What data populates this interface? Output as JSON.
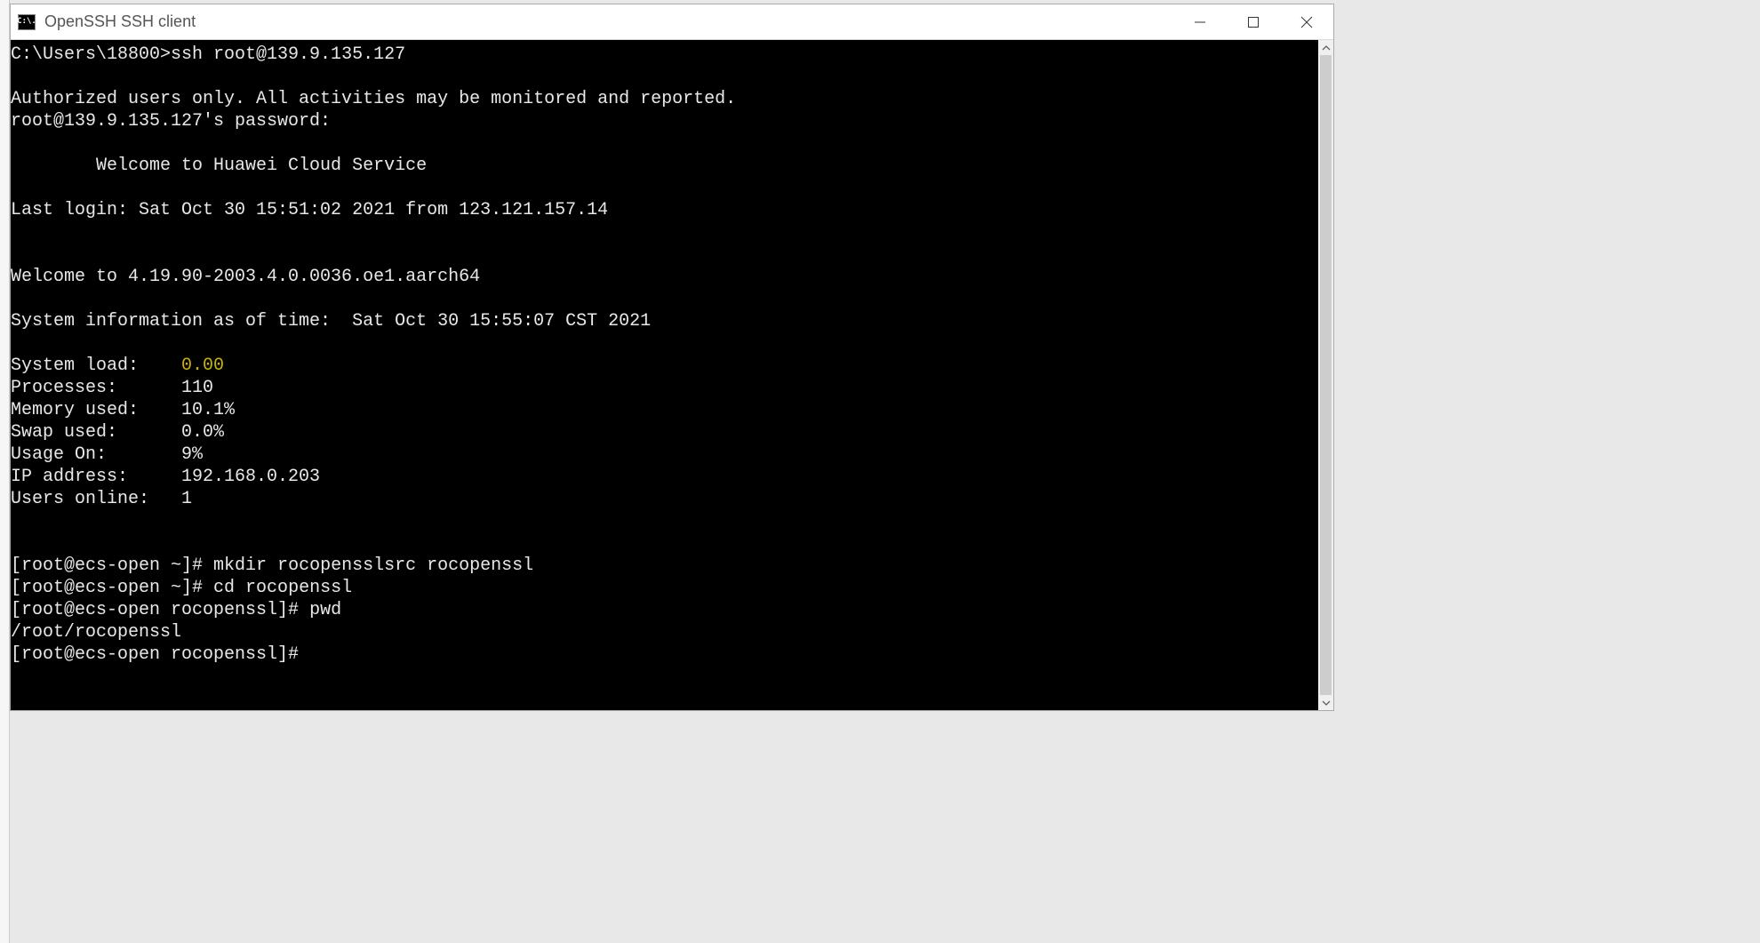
{
  "window": {
    "icon_text": "C:\\.",
    "title": "OpenSSH SSH client"
  },
  "terminal": {
    "prompt_windows": "C:\\Users\\18800>",
    "ssh_command": "ssh root@139.9.135.127",
    "auth_notice": "Authorized users only. All activities may be monitored and reported.",
    "password_prompt": "root@139.9.135.127's password:",
    "welcome_banner": "        Welcome to Huawei Cloud Service",
    "last_login": "Last login: Sat Oct 30 15:51:02 2021 from 123.121.157.14",
    "kernel_welcome": "Welcome to 4.19.90-2003.4.0.0036.oe1.aarch64",
    "sysinfo_time_line": "System information as of time:  Sat Oct 30 15:55:07 CST 2021",
    "sysinfo": {
      "system_load_label": "System load:",
      "system_load_value": "0.00",
      "processes_label": "Processes:",
      "processes_value": "110",
      "memory_label": "Memory used:",
      "memory_value": "10.1%",
      "swap_label": "Swap used:",
      "swap_value": "0.0%",
      "usage_label": "Usage On:",
      "usage_value": "9%",
      "ip_label": "IP address:",
      "ip_value": "192.168.0.203",
      "users_label": "Users online:",
      "users_value": "1"
    },
    "lines": {
      "l1_prompt": "[root@ecs-open ~]#",
      "l1_cmd": " mkdir rocopensslsrc rocopenssl",
      "l2_prompt": "[root@ecs-open ~]#",
      "l2_cmd": " cd rocopenssl",
      "l3_prompt": "[root@ecs-open rocopenssl]#",
      "l3_cmd": " pwd",
      "l3_out": "/root/rocopenssl",
      "l4_prompt": "[root@ecs-open rocopenssl]#"
    }
  }
}
